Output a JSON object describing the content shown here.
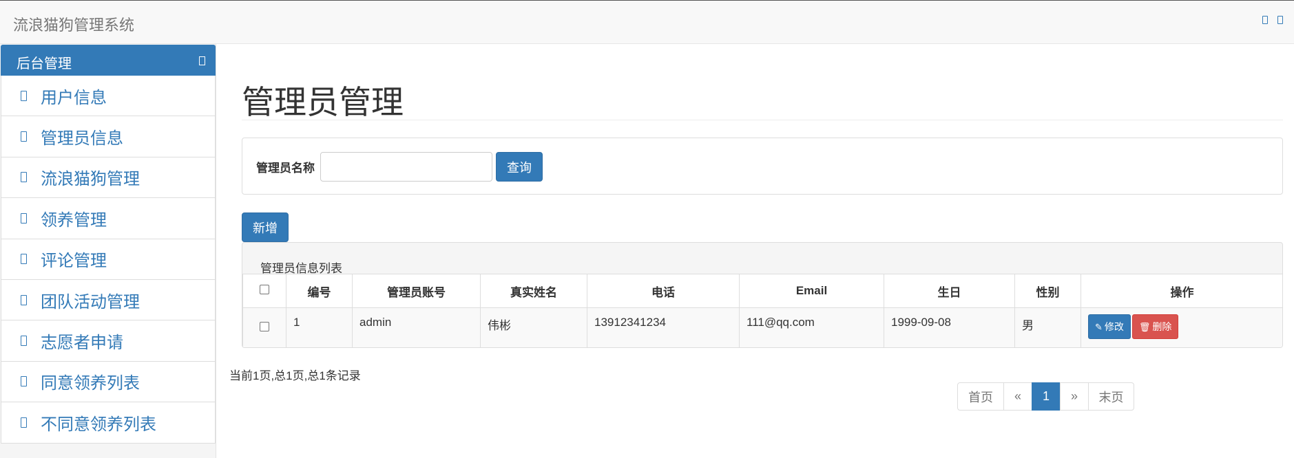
{
  "app": {
    "title": "流浪猫狗管理系统"
  },
  "sidebar": {
    "header": "后台管理",
    "items": [
      {
        "label": "用户信息"
      },
      {
        "label": "管理员信息"
      },
      {
        "label": "流浪猫狗管理"
      },
      {
        "label": "领养管理"
      },
      {
        "label": "评论管理"
      },
      {
        "label": "团队活动管理"
      },
      {
        "label": "志愿者申请"
      },
      {
        "label": "同意领养列表"
      },
      {
        "label": "不同意领养列表"
      }
    ]
  },
  "page": {
    "title": "管理员管理"
  },
  "search": {
    "label": "管理员名称",
    "value": "",
    "placeholder": "",
    "button": "查询"
  },
  "actions": {
    "add": "新增"
  },
  "table": {
    "caption": "管理员信息列表",
    "columns": [
      "编号",
      "管理员账号",
      "真实姓名",
      "电话",
      "Email",
      "生日",
      "性别",
      "操作"
    ],
    "rows": [
      {
        "id": "1",
        "account": "admin",
        "real_name": "伟彬",
        "phone": "13912341234",
        "email": "111@qq.com",
        "birthday": "1999-09-08",
        "gender": "男",
        "edit": "修改",
        "delete": "删除"
      }
    ]
  },
  "pagination": {
    "info": "当前1页,总1页,总1条记录",
    "first": "首页",
    "prev": "«",
    "current": "1",
    "next": "»",
    "last": "末页"
  },
  "colors": {
    "primary": "#337ab7",
    "danger": "#d9534f"
  }
}
